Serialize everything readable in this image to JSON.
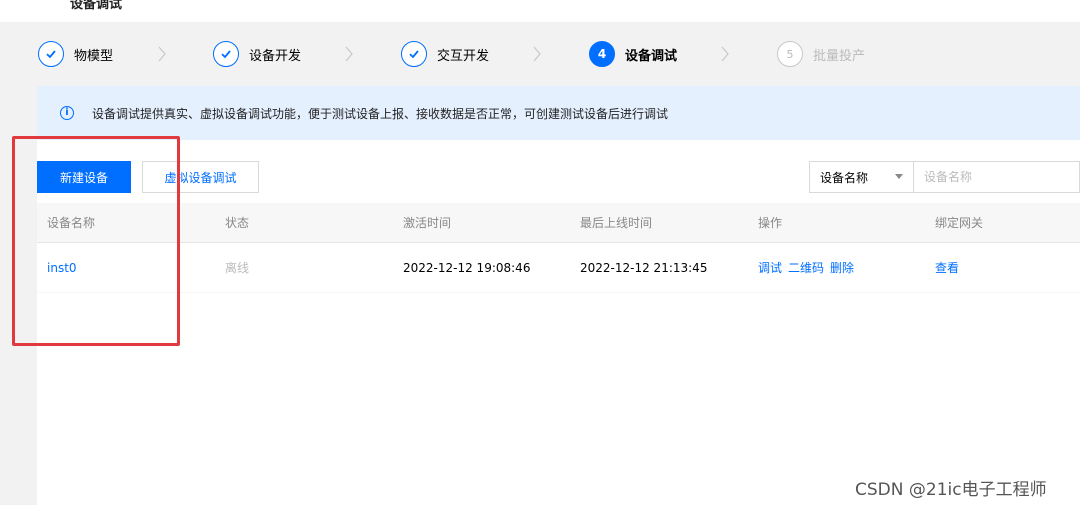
{
  "header": {
    "breadcrumb": "设备调试"
  },
  "steps": [
    {
      "number": "1",
      "label": "物模型",
      "state": "done"
    },
    {
      "number": "2",
      "label": "设备开发",
      "state": "done"
    },
    {
      "number": "3",
      "label": "交互开发",
      "state": "done"
    },
    {
      "number": "4",
      "label": "设备调试",
      "state": "active"
    },
    {
      "number": "5",
      "label": "批量投产",
      "state": "pending"
    }
  ],
  "info": {
    "icon": "info-icon",
    "text": "设备调试提供真实、虚拟设备调试功能，便于测试设备上报、接收数据是否正常，可创建测试设备后进行调试"
  },
  "toolbar": {
    "new_device_label": "新建设备",
    "virtual_debug_label": "虚拟设备调试",
    "search_field_selected": "设备名称",
    "search_placeholder": "设备名称"
  },
  "table": {
    "columns": [
      "设备名称",
      "状态",
      "激活时间",
      "最后上线时间",
      "操作",
      "绑定网关"
    ],
    "rows": [
      {
        "name": "inst0",
        "status": "离线",
        "activated": "2022-12-12 19:08:46",
        "last_online": "2022-12-12 21:13:45",
        "actions": [
          "调试",
          "二维码",
          "删除"
        ],
        "gateway": "查看"
      }
    ]
  },
  "watermark": "CSDN @21ic电子工程师",
  "colors": {
    "accent": "#006eff",
    "highlight": "#e0393e",
    "info_bg": "#e5f0ff"
  }
}
